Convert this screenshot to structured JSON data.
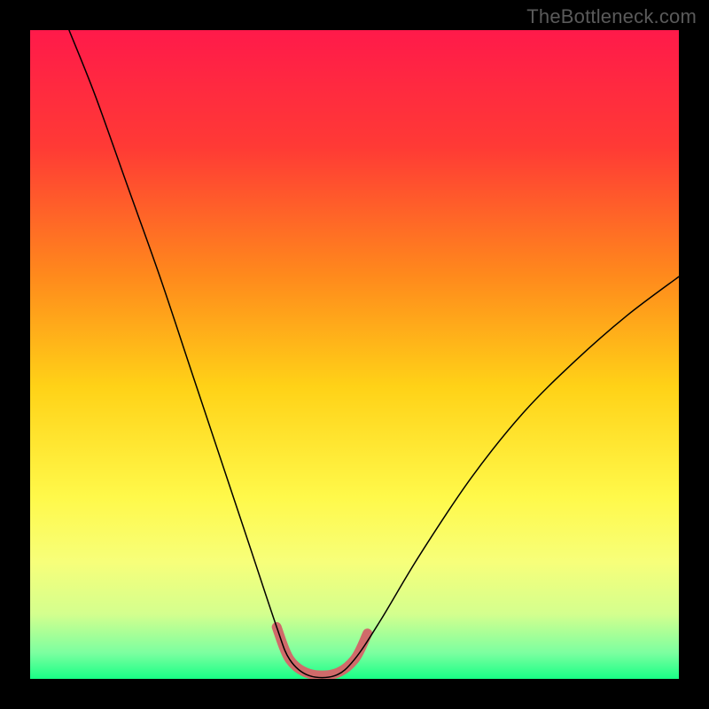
{
  "watermark": "TheBottleneck.com",
  "chart_data": {
    "type": "line",
    "title": "",
    "xlabel": "",
    "ylabel": "",
    "xlim": [
      0,
      100
    ],
    "ylim": [
      0,
      100
    ],
    "grid": false,
    "legend": false,
    "gradient_background": {
      "stops": [
        {
          "offset": 0.0,
          "color": "#ff1a4a"
        },
        {
          "offset": 0.18,
          "color": "#ff3a35"
        },
        {
          "offset": 0.38,
          "color": "#ff8a1c"
        },
        {
          "offset": 0.55,
          "color": "#ffd217"
        },
        {
          "offset": 0.72,
          "color": "#fff94a"
        },
        {
          "offset": 0.82,
          "color": "#f7ff7a"
        },
        {
          "offset": 0.9,
          "color": "#d4ff8e"
        },
        {
          "offset": 0.96,
          "color": "#7cffa0"
        },
        {
          "offset": 1.0,
          "color": "#18ff86"
        }
      ]
    },
    "series": [
      {
        "name": "bottleneck-curve",
        "color": "#000000",
        "stroke_width": 1.5,
        "points": [
          {
            "x": 6,
            "y": 100
          },
          {
            "x": 10,
            "y": 90
          },
          {
            "x": 15,
            "y": 76
          },
          {
            "x": 20,
            "y": 62
          },
          {
            "x": 25,
            "y": 47
          },
          {
            "x": 30,
            "y": 32
          },
          {
            "x": 34,
            "y": 20
          },
          {
            "x": 38,
            "y": 8
          },
          {
            "x": 40,
            "y": 3
          },
          {
            "x": 43,
            "y": 0.5
          },
          {
            "x": 47,
            "y": 0.5
          },
          {
            "x": 50,
            "y": 3
          },
          {
            "x": 54,
            "y": 9
          },
          {
            "x": 60,
            "y": 19
          },
          {
            "x": 68,
            "y": 31
          },
          {
            "x": 76,
            "y": 41
          },
          {
            "x": 84,
            "y": 49
          },
          {
            "x": 92,
            "y": 56
          },
          {
            "x": 100,
            "y": 62
          }
        ]
      },
      {
        "name": "trough-highlight",
        "color": "#d06a6a",
        "stroke_width": 11,
        "linecap": "round",
        "points": [
          {
            "x": 38,
            "y": 8
          },
          {
            "x": 40,
            "y": 3
          },
          {
            "x": 43,
            "y": 0.8
          },
          {
            "x": 47,
            "y": 0.8
          },
          {
            "x": 50,
            "y": 3
          },
          {
            "x": 52,
            "y": 7
          }
        ]
      }
    ]
  }
}
